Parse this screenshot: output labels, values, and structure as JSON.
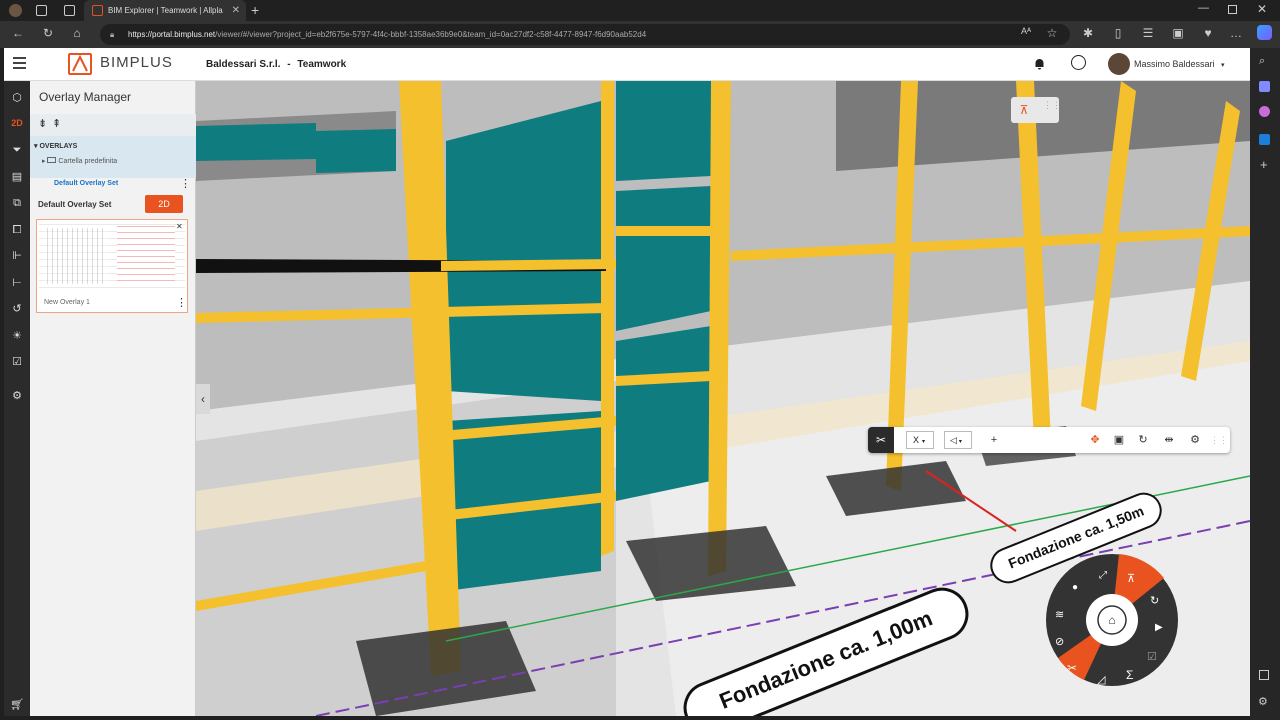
{
  "browser": {
    "tab_title": "BIM Explorer | Teamwork | Allpla",
    "url_host": "https://portal.bimplus.net",
    "url_path": "/viewer/#/viewer?project_id=eb2f675e-5797-4f4c-bbbf-1358ae36b9e0&team_id=0ac27df2-c58f-4477-8947-f6d90aab52d4"
  },
  "header": {
    "logo_text": "BIMPLUS",
    "company": "Baldessari S.r.l.",
    "separator": "-",
    "team": "Teamwork",
    "user_name": "Massimo Baldessari"
  },
  "panel": {
    "title": "Overlay Manager",
    "section_label": "OVERLAYS",
    "folder_label": "Cartella predefinita",
    "set_label": "Default Overlay Set",
    "set_title": "Default Overlay Set",
    "toggle_label": "2D",
    "overlay_name": "New Overlay 1"
  },
  "viewport": {
    "label_1": "Fondazione ca. 1,00m",
    "label_2": "Fondazione ca. 1,50m",
    "axis_select": "X"
  },
  "colors": {
    "accent": "#e8531f",
    "beam_yellow": "#f5c02d",
    "teal": "#0f7c80",
    "rail_dark": "#2b2b2b"
  },
  "icons": {
    "rail": [
      "cube-icon",
      "2d-icon",
      "filter-icon",
      "clipboard-icon",
      "copy-icon",
      "layers-icon",
      "hierarchy-icon",
      "tree-icon",
      "history-icon",
      "sun-icon",
      "checklist-icon",
      "gear-icon",
      "cart-icon"
    ]
  }
}
